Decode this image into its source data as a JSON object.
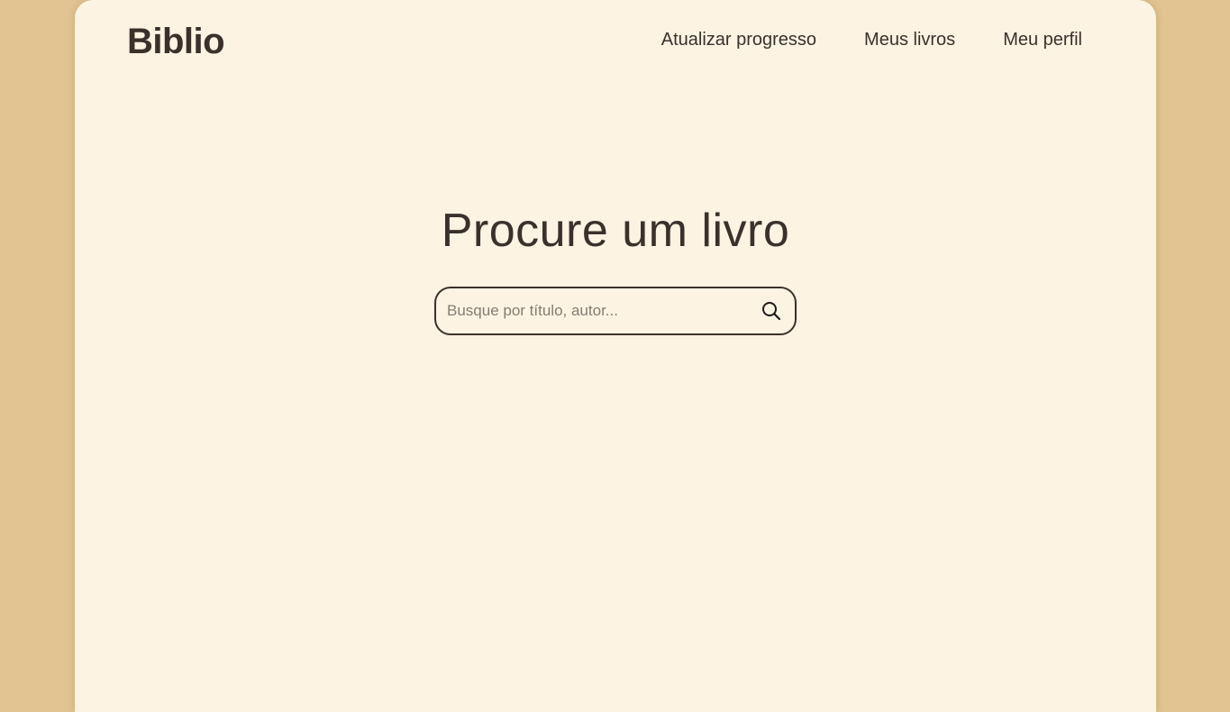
{
  "app": {
    "brand": "Biblio"
  },
  "nav": {
    "items": [
      {
        "label": "Atualizar progresso"
      },
      {
        "label": "Meus livros"
      },
      {
        "label": "Meu perfil"
      }
    ]
  },
  "main": {
    "title": "Procure um livro",
    "search": {
      "placeholder": "Busque por título, autor...",
      "value": "",
      "icon": "search-icon"
    }
  },
  "colors": {
    "background": "#e1c492",
    "card": "#fcf3e3",
    "text": "#3c302b"
  }
}
